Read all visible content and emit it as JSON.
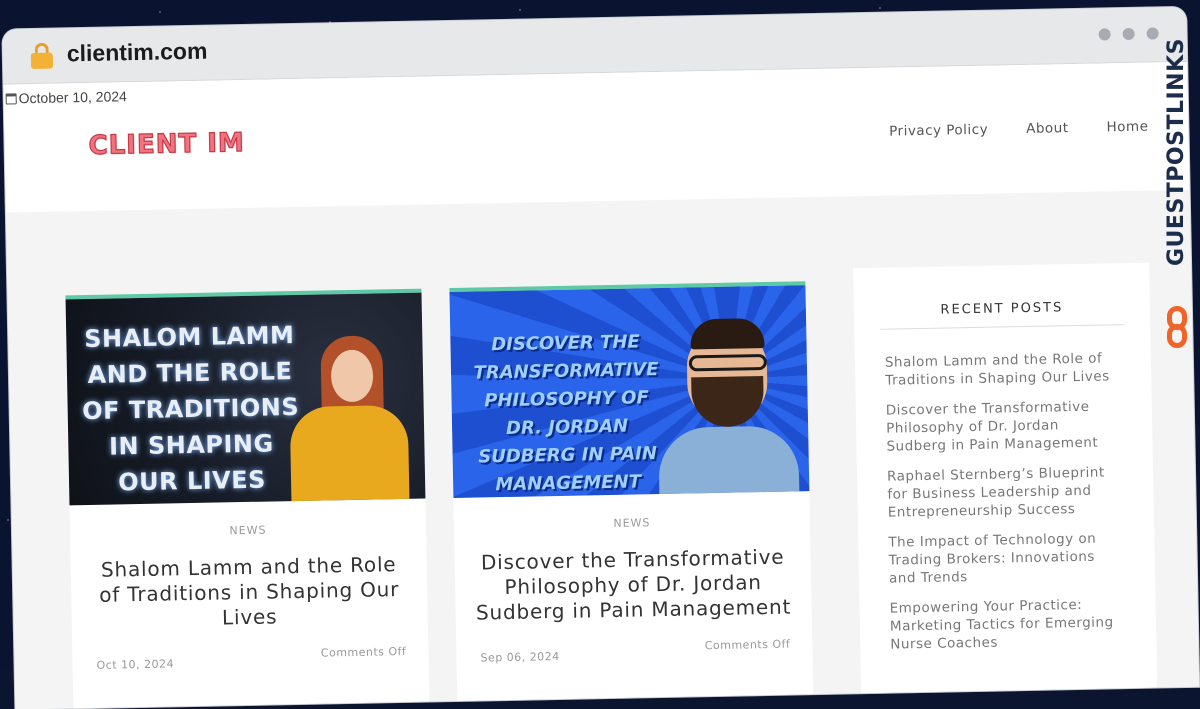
{
  "browser": {
    "url": "clientim.com"
  },
  "site": {
    "date": "October 10, 2024",
    "logo": "CLIENT IM",
    "nav": [
      "Privacy Policy",
      "About",
      "Home"
    ]
  },
  "posts": [
    {
      "thumb_text": "Shalom Lamm and the Role of Traditions in Shaping Our Lives",
      "category": "NEWS",
      "title": "Shalom Lamm and the Role of Traditions in Shaping Our Lives",
      "date": "Oct 10, 2024",
      "comments": "Comments Off"
    },
    {
      "thumb_text": "Discover the Transformative Philosophy of Dr. Jordan Sudberg in Pain Management",
      "category": "NEWS",
      "title": "Discover the Transformative Philosophy of Dr. Jordan Sudberg in Pain Management",
      "date": "Sep 06, 2024",
      "comments": "Comments Off"
    }
  ],
  "sidebar": {
    "title": "RECENT POSTS",
    "items": [
      "Shalom Lamm and the Role of Traditions in Shaping Our Lives",
      "Discover the Transformative Philosophy of Dr. Jordan Sudberg in Pain Management",
      "Raphael Sternberg’s Blueprint for Business Leadership and Entrepreneurship Success",
      "The Impact of Technology on Trading Brokers: Innovations and Trends",
      "Empowering Your Practice: Marketing Tactics for Emerging Nurse Coaches"
    ]
  },
  "watermark": {
    "text": "GUESTPOSTLINKS"
  },
  "colors": {
    "accent": "#5fc9a6",
    "logo": "#f2737f",
    "watermark_icon": "#f0642a"
  }
}
